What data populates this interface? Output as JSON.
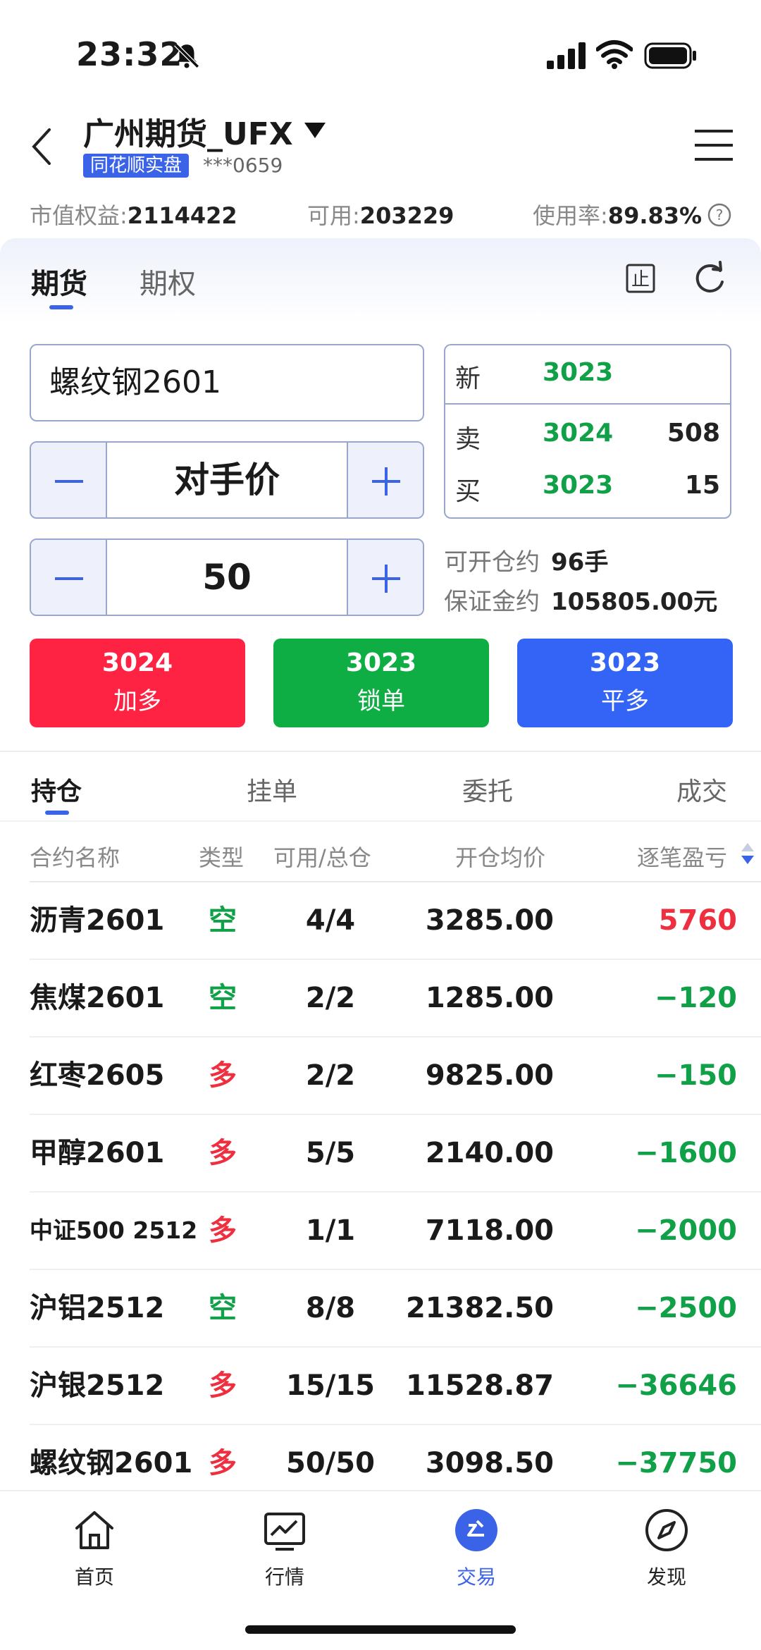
{
  "status": {
    "time": "23:32"
  },
  "header": {
    "broker": "广州期货_UFX",
    "badge": "同花顺实盘",
    "account": "***0659"
  },
  "summary": {
    "equity_label": "市值权益:",
    "equity": "2114422",
    "available_label": "可用:",
    "available": "203229",
    "usage_label": "使用率:",
    "usage": "89.83%"
  },
  "tabs": [
    "期货",
    "期权"
  ],
  "order": {
    "contract": "螺纹钢2601",
    "price_type": "对手价",
    "quantity": "50"
  },
  "quote": {
    "last_label": "新",
    "last": "3023",
    "ask_label": "卖",
    "ask": "3024",
    "ask_qty": "508",
    "bid_label": "买",
    "bid": "3023",
    "bid_qty": "15"
  },
  "info": {
    "open_label": "可开仓约",
    "open_value": "96手",
    "margin_label": "保证金约",
    "margin_value": "105805.00元"
  },
  "actions": [
    {
      "price": "3024",
      "label": "加多",
      "color": "#fe2342"
    },
    {
      "price": "3023",
      "label": "锁单",
      "color": "#0fae44"
    },
    {
      "price": "3023",
      "label": "平多",
      "color": "#3464f5"
    }
  ],
  "position_tabs": [
    "持仓",
    "挂单",
    "委托",
    "成交"
  ],
  "table": {
    "headers": [
      "合约名称",
      "类型",
      "可用/总仓",
      "开仓均价",
      "逐笔盈亏"
    ],
    "rows": [
      {
        "name": "沥青2601",
        "dir": "空",
        "qty": "4/4",
        "avg": "3285.00",
        "pnl": "5760"
      },
      {
        "name": "焦煤2601",
        "dir": "空",
        "qty": "2/2",
        "avg": "1285.00",
        "pnl": "−120"
      },
      {
        "name": "红枣2605",
        "dir": "多",
        "qty": "2/2",
        "avg": "9825.00",
        "pnl": "−150"
      },
      {
        "name": "甲醇2601",
        "dir": "多",
        "qty": "5/5",
        "avg": "2140.00",
        "pnl": "−1600"
      },
      {
        "name": "中证500 2512",
        "dir": "多",
        "qty": "1/1",
        "avg": "7118.00",
        "pnl": "−2000"
      },
      {
        "name": "沪铝2512",
        "dir": "空",
        "qty": "8/8",
        "avg": "21382.50",
        "pnl": "−2500"
      },
      {
        "name": "沪银2512",
        "dir": "多",
        "qty": "15/15",
        "avg": "11528.87",
        "pnl": "−36646"
      },
      {
        "name": "螺纹钢2601",
        "dir": "多",
        "qty": "50/50",
        "avg": "3098.50",
        "pnl": "−37750"
      }
    ]
  },
  "nav": [
    {
      "label": "首页",
      "icon": "home-icon"
    },
    {
      "label": "行情",
      "icon": "chart-icon"
    },
    {
      "label": "交易",
      "icon": "trade-icon"
    },
    {
      "label": "发现",
      "icon": "compass-icon"
    }
  ]
}
